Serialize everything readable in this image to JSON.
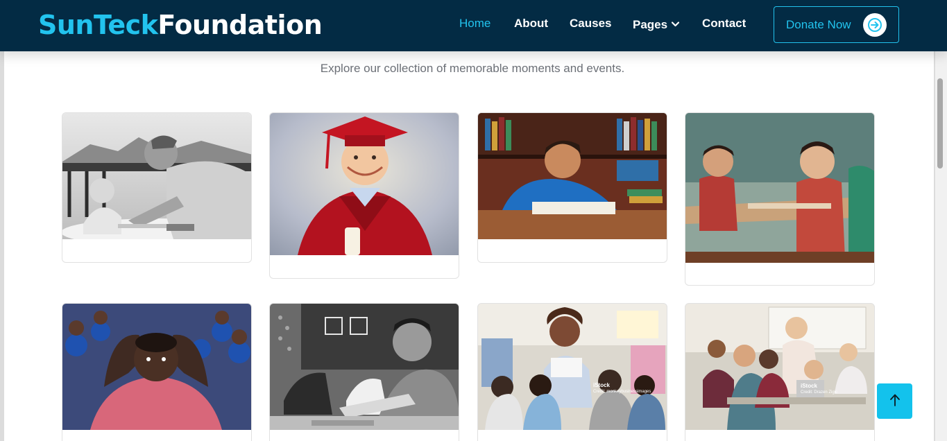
{
  "brand": {
    "part1": "SunTeck",
    "part2": "Foundation"
  },
  "nav": {
    "items": [
      {
        "label": "Home",
        "active": true
      },
      {
        "label": "About",
        "active": false
      },
      {
        "label": "Causes",
        "active": false
      },
      {
        "label": "Pages",
        "active": false,
        "dropdown": true
      },
      {
        "label": "Contact",
        "active": false
      }
    ],
    "donate_label": "Donate Now"
  },
  "gallery": {
    "subtitle": "Explore our collection of memorable moments and events.",
    "items": [
      {
        "image": "father and daughter drawing, black and white"
      },
      {
        "image": "boy in red graduation gown and cap"
      },
      {
        "image": "boy writing in a notebook in a library"
      },
      {
        "image": "young students at classroom desks"
      },
      {
        "image": "boy with hands on head in a crowd of students"
      },
      {
        "image": "students at desks before a chalkboard, black and white"
      },
      {
        "image": "teacher reading to children seated on the floor",
        "watermark": {
          "brand": "iStock",
          "credit": "Credit: monkeybusinessimages"
        }
      },
      {
        "image": "teacher helping students at laptops",
        "watermark": {
          "brand": "iStock",
          "credit": "Credit: Drazen Zigic"
        }
      }
    ]
  },
  "colors": {
    "navbar": "#032b44",
    "accent": "#22c3ee",
    "to_top": "#13c2ec"
  },
  "icons": {
    "dropdown": "chevron-down-icon",
    "donate": "arrow-right-icon",
    "to_top": "arrow-up-icon"
  }
}
